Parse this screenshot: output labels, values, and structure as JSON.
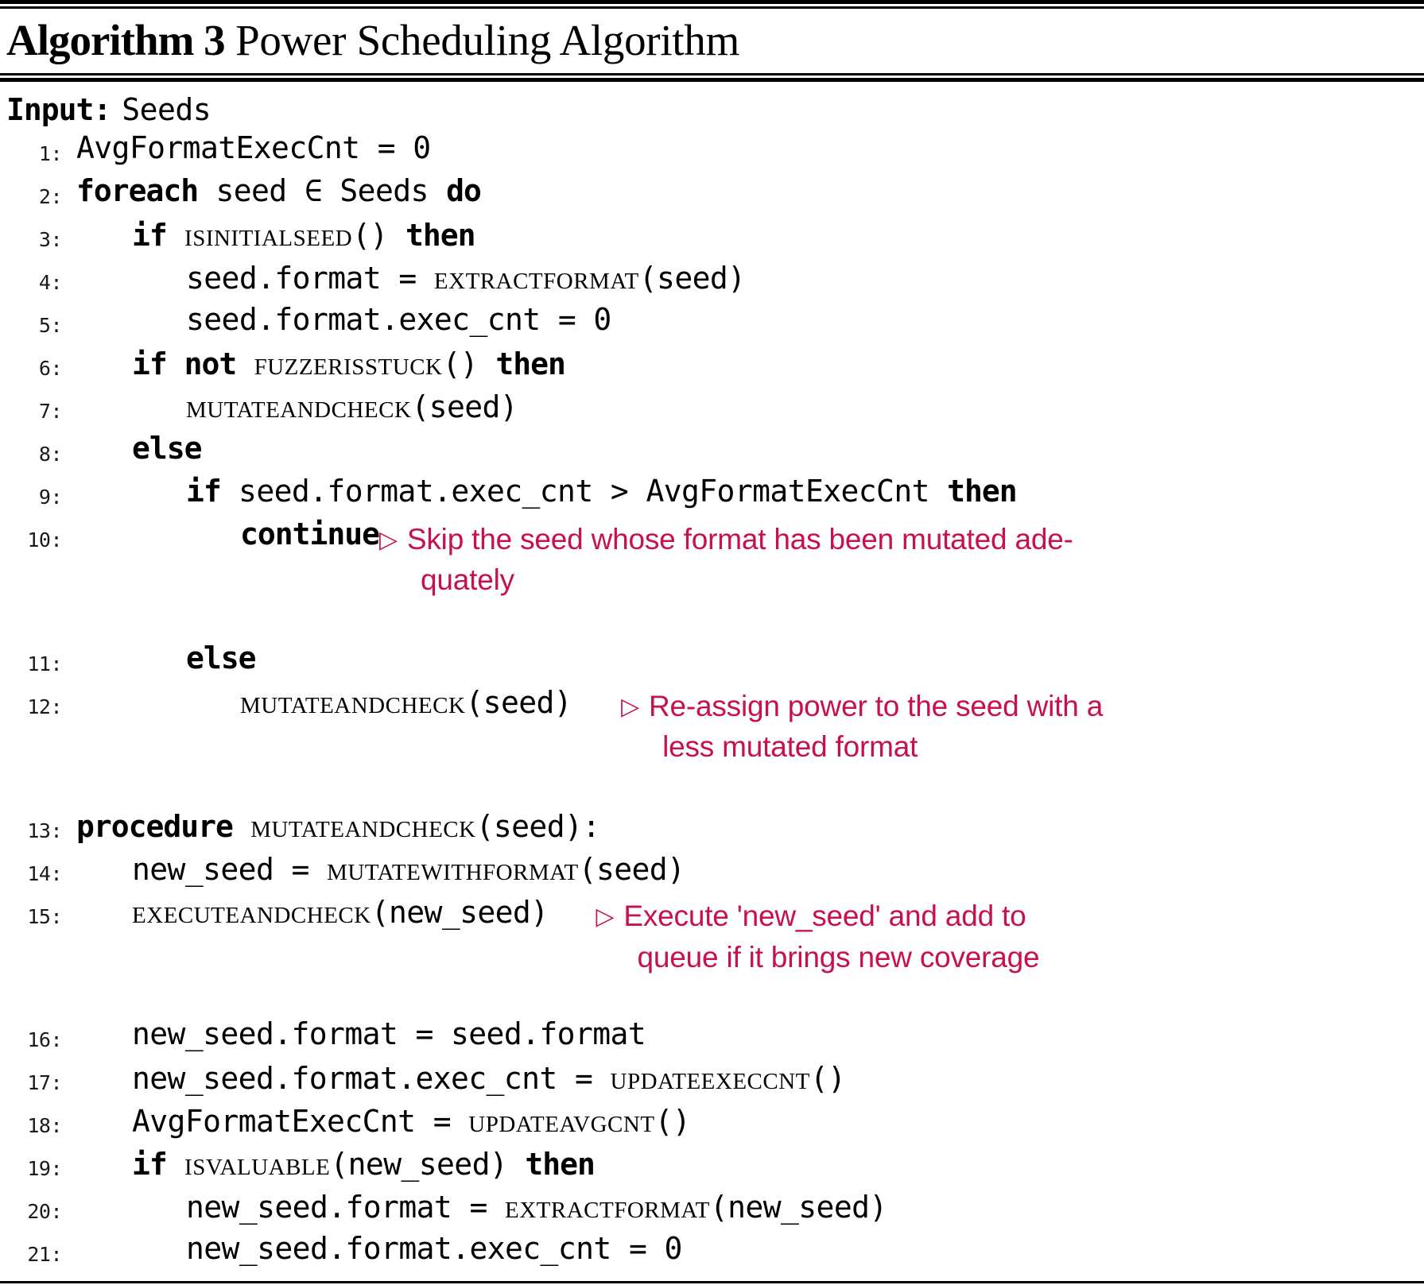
{
  "header": {
    "algorithm_label": "Algorithm 3",
    "algorithm_title": "Power Scheduling Algorithm"
  },
  "input": {
    "label": "Input:",
    "value": "Seeds"
  },
  "comment_color": "#C8104E",
  "comment_marker": "▷",
  "lines": {
    "n1": "1:",
    "n2": "2:",
    "n3": "3:",
    "n4": "4:",
    "n5": "5:",
    "n6": "6:",
    "n7": "7:",
    "n8": "8:",
    "n9": "9:",
    "n10": "10:",
    "n11": "11:",
    "n12": "12:",
    "n13": "13:",
    "n14": "14:",
    "n15": "15:",
    "n16": "16:",
    "n17": "17:",
    "n18": "18:",
    "n19": "19:",
    "n20": "20:",
    "n21": "21:"
  },
  "code": {
    "l1_text": "AvgFormatExecCnt = 0",
    "l2_kw1": "foreach",
    "l2_mid": "seed ∈ Seeds",
    "l2_kw2": "do",
    "l3_kw1": "if",
    "l3_fn": "IsInitialSeed",
    "l3_args": "()",
    "l3_kw2": "then",
    "l4_lhs": "seed.format = ",
    "l4_fn": "ExtractFormat",
    "l4_args": "(seed)",
    "l5_text": "seed.format.exec_cnt = 0",
    "l6_kw1": "if not",
    "l6_fn": "FuzzerIsStuck",
    "l6_args": "()",
    "l6_kw2": "then",
    "l7_fn": "MutateAndCheck",
    "l7_args": "(seed)",
    "l8_kw": "else",
    "l9_kw1": "if",
    "l9_cond": "seed.format.exec_cnt > AvgFormatExecCnt",
    "l9_kw2": "then",
    "l10_kw": "continue",
    "l10_comment_a": "Skip the seed whose format has been mutated ade-",
    "l10_comment_b": "quately",
    "l11_kw": "else",
    "l12_fn": "MutateAndCheck",
    "l12_args": "(seed)",
    "l12_comment_a": "Re-assign power to the seed with a",
    "l12_comment_b": "less mutated format",
    "l13_kw": "procedure",
    "l13_fn": "MutateAndCheck",
    "l13_args": "(seed):",
    "l14_lhs": "new_seed = ",
    "l14_fn": "MutateWithFormat",
    "l14_args": "(seed)",
    "l15_fn": "ExecuteAndCheck",
    "l15_args": "(new_seed)",
    "l15_comment_a": "Execute 'new_seed' and add to",
    "l15_comment_b": "queue if it brings new coverage",
    "l16_text": "new_seed.format = seed.format",
    "l17_lhs": "new_seed.format.exec_cnt = ",
    "l17_fn": "UpdateExecCnt",
    "l17_args": "()",
    "l18_lhs": "AvgFormatExecCnt = ",
    "l18_fn": "UpdateAvgCnt",
    "l18_args": "()",
    "l19_kw1": "if",
    "l19_fn": "IsValuable",
    "l19_args": "(new_seed)",
    "l19_kw2": "then",
    "l20_lhs": "new_seed.format = ",
    "l20_fn": "ExtractFormat",
    "l20_args": "(new_seed)",
    "l21_text": "new_seed.format.exec_cnt = 0"
  }
}
